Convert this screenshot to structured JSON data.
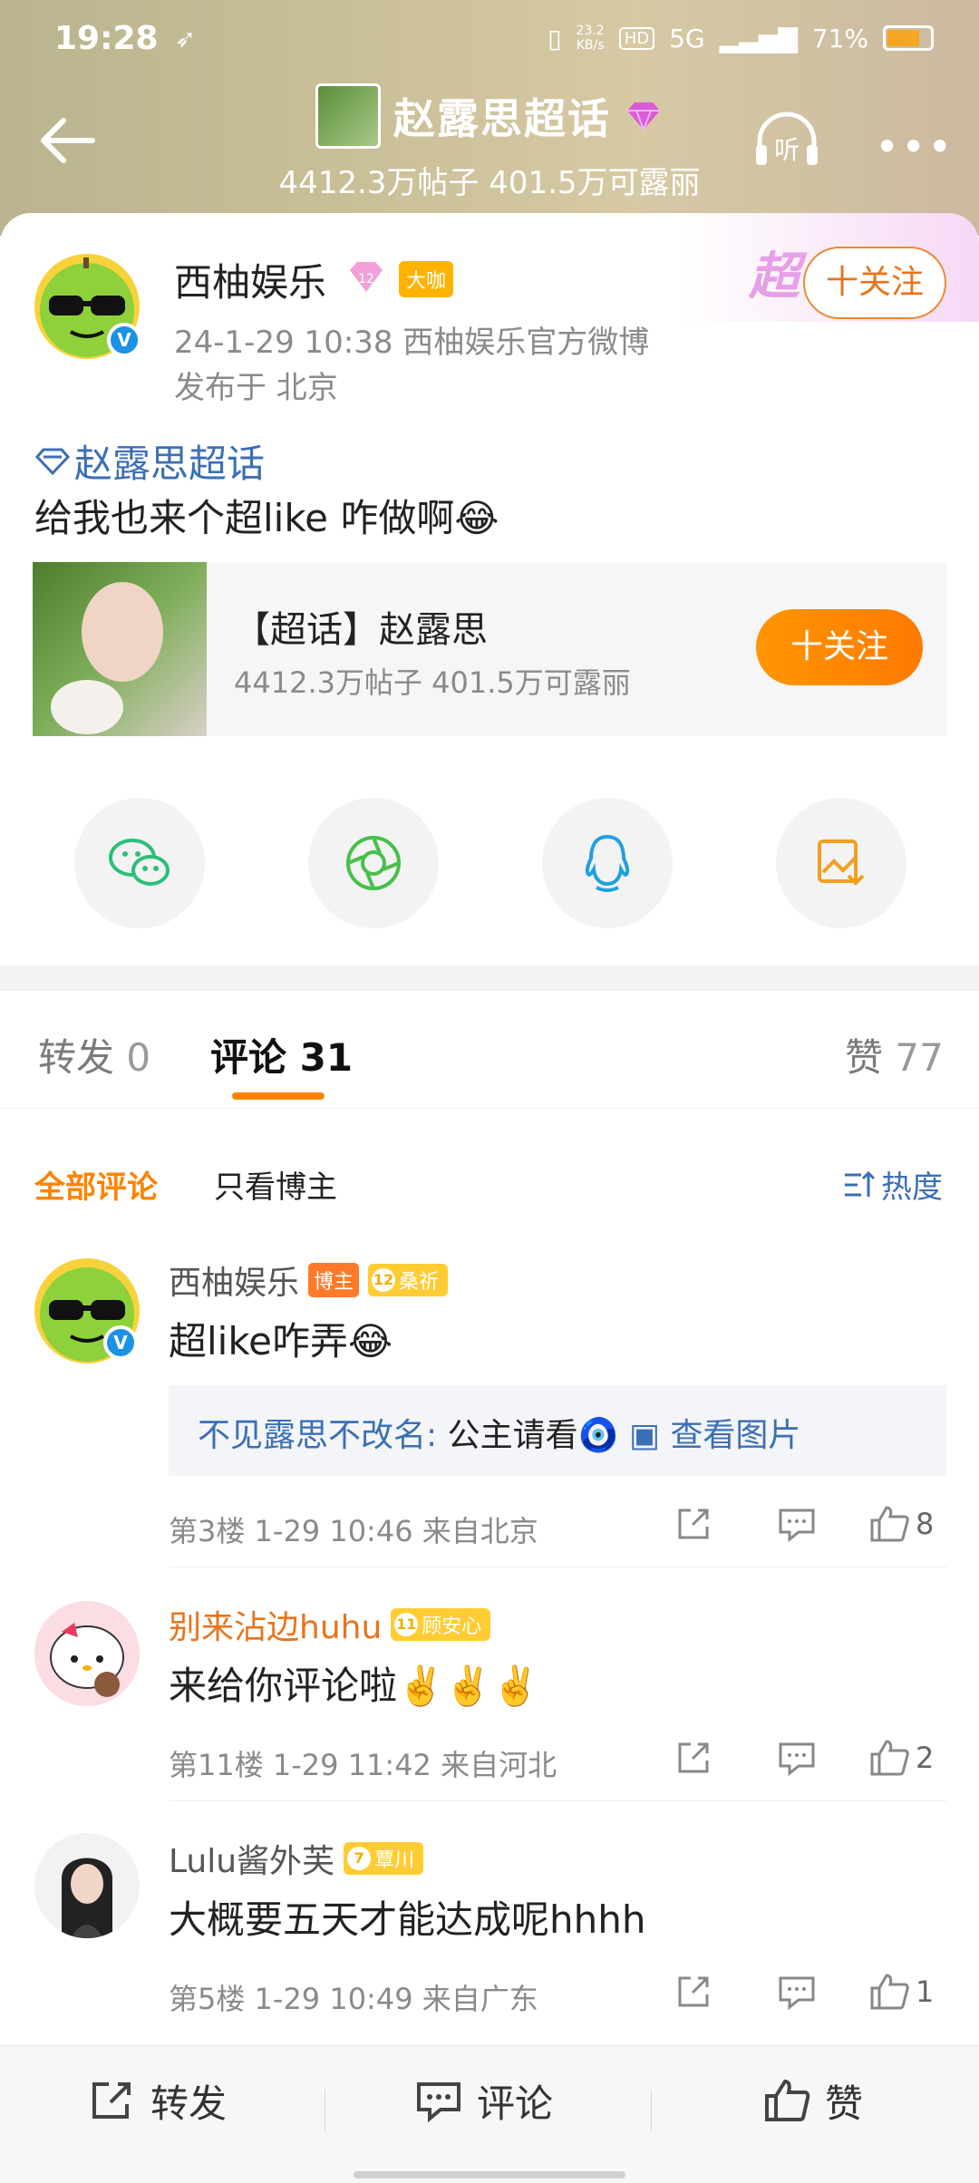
{
  "status_bar": {
    "time": "19:28",
    "net_speed": "23.2\nKB/s",
    "hd": "HD",
    "signal": "5G",
    "battery": "71%",
    "battery_level": 0.71
  },
  "header": {
    "title": "赵露思超话",
    "subtitle": "4412.3万帖子  401.5万可露丽"
  },
  "post": {
    "author": "西柚娱乐",
    "level": "12",
    "tag": "大咖",
    "follow_label": "十关注",
    "time_source": "24-1-29 10:38   西柚娱乐官方微博",
    "location": "发布于 北京",
    "topic": "赵露思超话",
    "text": "给我也来个超like 咋做啊😂",
    "super_mark": "超"
  },
  "super_card": {
    "title": "【超话】赵露思",
    "stats": "4412.3万帖子  401.5万可露丽",
    "follow_label": "十关注"
  },
  "share": [
    "wechat",
    "moments",
    "qq",
    "save-image"
  ],
  "tabs": [
    {
      "label": "转发",
      "count": "0"
    },
    {
      "label": "评论",
      "count": "31"
    },
    {
      "label": "赞",
      "count": "77"
    }
  ],
  "filters": {
    "all": "全部评论",
    "author_only": "只看博主",
    "sort": "热度"
  },
  "comments": [
    {
      "name": "西柚娱乐",
      "badge": "博主",
      "level": "12",
      "level_tag": "桑祈",
      "text": "超like咋弄😂",
      "reply_user": "不见露思不改名:",
      "reply_text": " 公主请看🧿",
      "reply_link": "查看图片",
      "floor": "第3楼  1-29 10:46  来自北京",
      "likes": "8"
    },
    {
      "name": "别来沾边huhu",
      "level": "11",
      "level_tag": "顾安心",
      "text": "来给你评论啦✌️✌️✌️",
      "floor": "第11楼  1-29 11:42  来自河北",
      "likes": "2"
    },
    {
      "name": "Lulu酱外芙",
      "level": "7",
      "level_tag": "覃川",
      "text": "大概要五天才能达成呢hhhh",
      "floor": "第5楼  1-29 10:49  来自广东",
      "likes": "1"
    }
  ],
  "bottom_bar": {
    "repost": "转发",
    "comment": "评论",
    "like": "赞"
  },
  "colors": {
    "accent": "#ff8200",
    "link": "#3b6fb6",
    "verified": "#1b92e5"
  }
}
